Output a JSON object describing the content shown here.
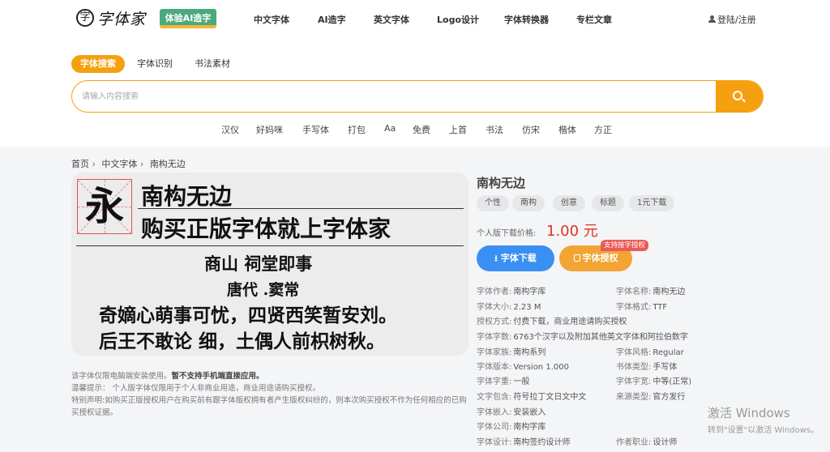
{
  "header": {
    "logo_mark": "字",
    "logo_text": "字体家",
    "ai_badge": "体验AI造字",
    "nav": [
      "中文字体",
      "AI造字",
      "英文字体",
      "Logo设计",
      "字体转换器",
      "专栏文章"
    ],
    "login": "登陆/注册"
  },
  "search": {
    "tabs": [
      "字体搜索",
      "字体识别",
      "书法素材"
    ],
    "placeholder": "请输入内容搜索",
    "hot_keywords": [
      "汉仪",
      "好妈咪",
      "手写体",
      "打包",
      "Aa",
      "免费",
      "上首",
      "书法",
      "仿宋",
      "楷体",
      "方正"
    ]
  },
  "breadcrumb": [
    "首页",
    "中文字体",
    "南构无边"
  ],
  "preview": {
    "yong_char": "永",
    "line1": "南构无边",
    "line2": "购买正版字体就上字体家",
    "poem_title": "商山 祠堂即事",
    "poem_author": "唐代 .窦常",
    "poem_line1": "奇嫡心萌事可忧，四贤西笑暂安刘。",
    "poem_line2": "后王不敢论 细，土偶人前枳树秋。"
  },
  "notes": {
    "n1_plain": "该字体仅限电脑端安装使用。",
    "n1_bold": "暂不支持手机端直接应用。",
    "n2": "温馨提示：  个人版字体仅限用于个人非商业用途，商业用途请购买授权。",
    "n3": "特别声明:如购买正版授权用户在购买前有跟字体版权拥有者产生版权纠纷的，则本次购买授权不作为任何相应的已购买授权证据。"
  },
  "font": {
    "name": "南构无边",
    "tags": [
      "个性",
      "南构",
      "创意",
      "标题",
      "1元下载"
    ],
    "price_label": "个人版下载价格:",
    "price": "1.00 元",
    "download_btn": "字体下载",
    "license_btn": "字体授权",
    "license_badge": "支持按字授权"
  },
  "details_left": [
    {
      "k": "字体作者:",
      "v": "南构字库"
    },
    {
      "k": "字体大小:",
      "v": "2.23 M"
    },
    {
      "k": "授权方式:",
      "v": "付费下载，商业用途请购买授权"
    },
    {
      "k": "字体字数:",
      "v": "6763个汉字以及附加其他英文字体和阿拉伯数字"
    },
    {
      "k": "字体家族:",
      "v": "南构系列"
    },
    {
      "k": "字体版本:",
      "v": "Version 1.000"
    },
    {
      "k": "字体字重:",
      "v": "一般"
    },
    {
      "k": "文字包含:",
      "v": "符号拉丁文日文中文"
    },
    {
      "k": "字体嵌入:",
      "v": "安装嵌入"
    },
    {
      "k": "字体公司:",
      "v": "南构字库"
    },
    {
      "k": "字体设计:",
      "v": "南构签约设计师"
    }
  ],
  "details_right": [
    {
      "k": "字体名称:",
      "v": "南构无边"
    },
    {
      "k": "字体格式:",
      "v": "TTF"
    },
    {
      "k": "字体风格:",
      "v": "Regular"
    },
    {
      "k": "书体类型:",
      "v": "手写体"
    },
    {
      "k": "字体字宽:",
      "v": "中等(正常)"
    },
    {
      "k": "来源类型:",
      "v": "官方发行"
    },
    {
      "k": "作者职业:",
      "v": "设计师"
    }
  ],
  "watermark": {
    "title": "激活 Windows",
    "subtitle": "转到\"设置\"以激活 Windows。"
  }
}
